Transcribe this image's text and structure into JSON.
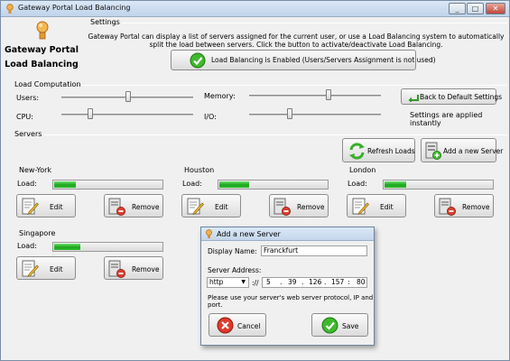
{
  "window": {
    "title": "Gateway Portal Load Balancing",
    "min_label": "_",
    "max_label": "□",
    "close_label": "✕"
  },
  "logo": {
    "line1": "Gateway Portal",
    "line2": "Load Balancing",
    "icon": "gateway-lamp-icon"
  },
  "settings": {
    "label": "Settings",
    "description_1": "Gateway Portal can display a list of servers assigned for the current user, or use a Load Balancing system to automatically split the load between servers.",
    "description_2": "Click the button to activate/deactivate Load Balancing.",
    "toggle_label": "Load Balancing is Enabled (Users/Servers Assignment is not used)",
    "toggle_icon": "checkmark-icon"
  },
  "load_computation": {
    "label": "Load Computation",
    "users_label": "Users:",
    "memory_label": "Memory:",
    "cpu_label": "CPU:",
    "io_label": "I/O:",
    "users_level": 0.51,
    "memory_level": 0.61,
    "cpu_level": 0.21,
    "io_level": 0.3,
    "default_button": "Back to Default Settings",
    "applied_note": "Settings are applied instantly"
  },
  "servers": {
    "label": "Servers",
    "refresh_label": "Refresh Loads",
    "add_label": "Add a new Server",
    "load_label": "Load:",
    "edit_label": "Edit",
    "remove_label": "Remove",
    "items": [
      {
        "name": "New-York",
        "load": 0.2
      },
      {
        "name": "Houston",
        "load": 0.27
      },
      {
        "name": "London",
        "load": 0.2
      },
      {
        "name": "Singapore",
        "load": 0.24
      }
    ]
  },
  "dialog": {
    "title": "Add a new Server",
    "display_name_label": "Display Name:",
    "display_name_value": "Franckfurt",
    "address_label": "Server Address:",
    "protocol_value": "http",
    "protocol_sep": "://",
    "ip_1": "5",
    "ip_2": "39",
    "ip_3": "126",
    "ip_4": "157",
    "port_sep": ":",
    "port_value": "80",
    "hint": "Please use your server's web server protocol, IP and port.",
    "cancel_label": "Cancel",
    "save_label": "Save"
  }
}
